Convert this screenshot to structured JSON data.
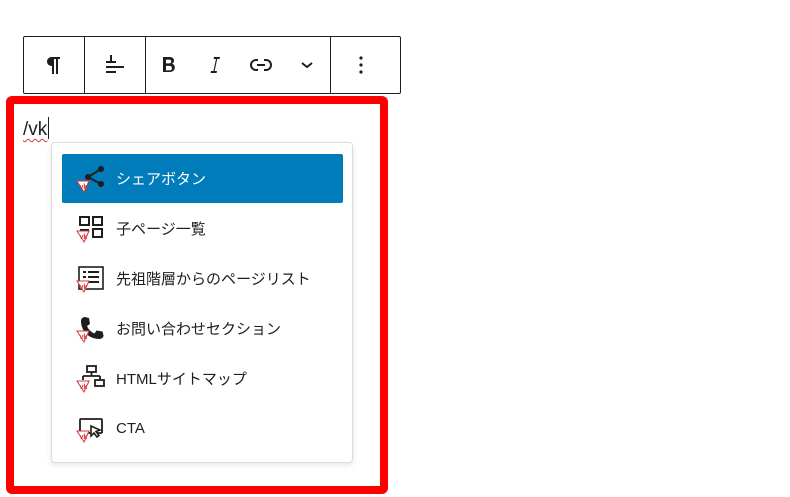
{
  "toolbar": {
    "buttons": [
      {
        "name": "paragraph",
        "icon": "pilcrow-icon"
      },
      {
        "name": "align",
        "icon": "align-text-icon"
      },
      {
        "name": "bold",
        "icon": "bold-icon"
      },
      {
        "name": "italic",
        "icon": "italic-icon"
      },
      {
        "name": "link",
        "icon": "link-icon"
      },
      {
        "name": "more",
        "icon": "chevron-down-icon"
      },
      {
        "name": "options",
        "icon": "kebab-menu-icon"
      }
    ]
  },
  "editor": {
    "typed_text": "/vk"
  },
  "autocomplete": {
    "items": [
      {
        "label": "シェアボタン",
        "icon": "share-icon",
        "selected": true
      },
      {
        "label": "子ページ一覧",
        "icon": "child-pages-grid-icon",
        "selected": false
      },
      {
        "label": "先祖階層からのページリスト",
        "icon": "page-list-icon",
        "selected": false
      },
      {
        "label": "お問い合わせセクション",
        "icon": "phone-icon",
        "selected": false
      },
      {
        "label": "HTMLサイトマップ",
        "icon": "sitemap-icon",
        "selected": false
      },
      {
        "label": "CTA",
        "icon": "cta-click-icon",
        "selected": false
      }
    ],
    "highlight_color": "#007cba"
  },
  "colors": {
    "frame": "#ff0000",
    "vk_badge": "#d63638"
  }
}
